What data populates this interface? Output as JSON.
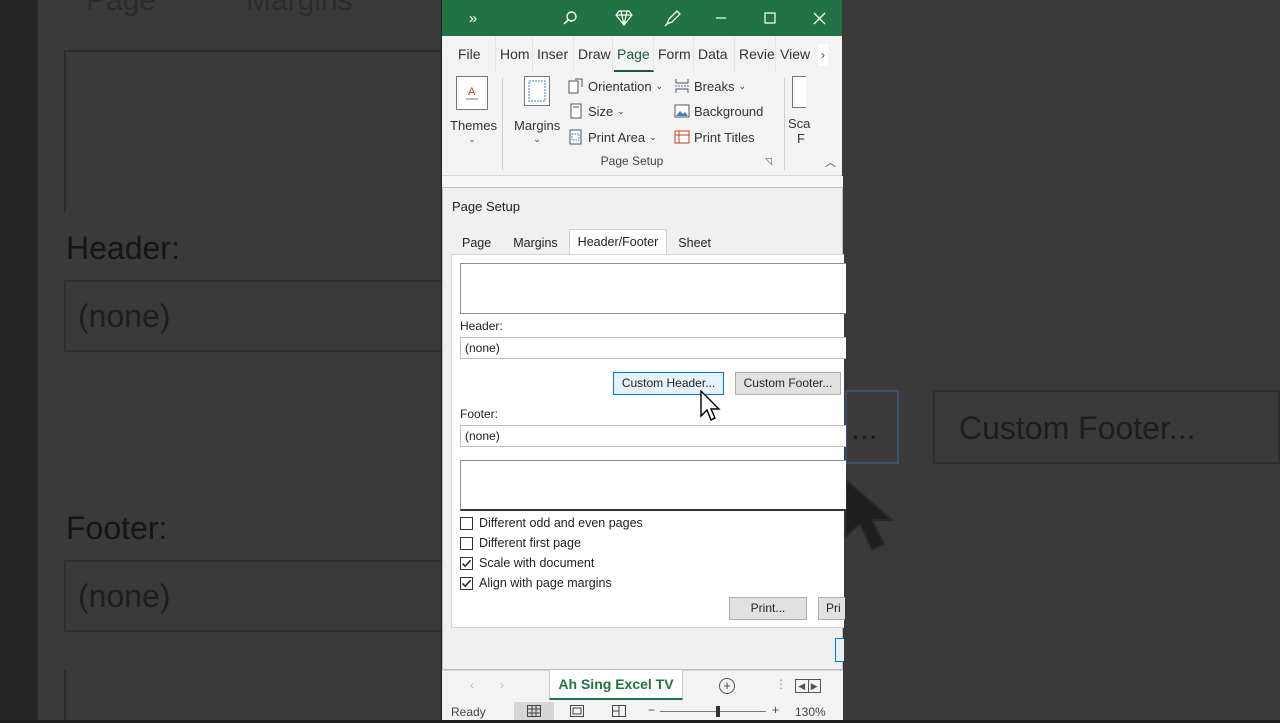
{
  "background": {
    "tabs": [
      "Page",
      "Margins"
    ],
    "header_label": "Header:",
    "header_value": "(none)",
    "footer_label": "Footer:",
    "footer_value": "(none)",
    "custom_header_partial": "...",
    "custom_footer": "Custom Footer..."
  },
  "titlebar": {
    "icons": [
      "chevrons-icon",
      "search-icon",
      "diamond-icon",
      "pen-icon",
      "minimize-icon",
      "maximize-icon",
      "close-icon"
    ],
    "color": "#217346"
  },
  "ribbon_tabs": [
    "File",
    "Hom",
    "Inser",
    "Draw",
    "Page",
    "Form",
    "Data",
    "Revie",
    "View"
  ],
  "ribbon": {
    "themes_label": "Themes",
    "margins_label": "Margins",
    "orientation_label": "Orientation",
    "size_label": "Size",
    "print_area_label": "Print Area",
    "breaks_label": "Breaks",
    "background_label": "Background",
    "print_titles_label": "Print Titles",
    "scale_label": "Sca",
    "scale_label2": "F",
    "group_label": "Page Setup"
  },
  "dialog": {
    "title": "Page Setup",
    "tabs": [
      "Page",
      "Margins",
      "Header/Footer",
      "Sheet"
    ],
    "active_tab": "Header/Footer",
    "header_label": "Header:",
    "header_value": "(none)",
    "custom_header_button": "Custom Header...",
    "custom_footer_button": "Custom Footer...",
    "footer_label": "Footer:",
    "footer_value": "(none)",
    "checkboxes": [
      {
        "label": "Different odd and even pages",
        "checked": false
      },
      {
        "label": "Different first page",
        "checked": false
      },
      {
        "label": "Scale with document",
        "checked": true
      },
      {
        "label": "Align with page margins",
        "checked": true
      }
    ],
    "print_button": "Print...",
    "print_preview_partial": "Pri"
  },
  "sheet": {
    "tab_name": "Ah Sing Excel TV"
  },
  "status": {
    "ready": "Ready",
    "zoom": "130%",
    "zoom_minus": "−",
    "zoom_plus": "+"
  }
}
